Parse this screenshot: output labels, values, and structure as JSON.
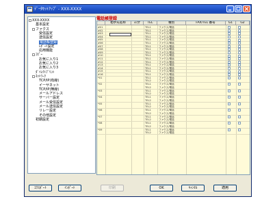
{
  "window": {
    "title": "ﾃﾞｰﾀｾｯﾄｱｯﾌﾟ - XXX-XXXX"
  },
  "tree": {
    "items": [
      {
        "label": "XXX-XXXX",
        "level": 0,
        "expander": true
      },
      {
        "label": "基本設定",
        "level": 1
      },
      {
        "label": "ファクス",
        "level": 1,
        "expander": true
      },
      {
        "label": "受信設定",
        "level": 2
      },
      {
        "label": "送信設定",
        "level": 2
      },
      {
        "label": "電話帳登録",
        "level": 2,
        "selected": true
      },
      {
        "label": "ﾚﾎﾟｰﾄ設定",
        "level": 2
      },
      {
        "label": "応用機能",
        "level": 2
      },
      {
        "label": "ｺﾋﾟｰ",
        "level": 1,
        "expander": true
      },
      {
        "label": "お気に入り1",
        "level": 2
      },
      {
        "label": "お気に入り2",
        "level": 2
      },
      {
        "label": "お気に入り3",
        "level": 2
      },
      {
        "label": "ﾀﾞｲﾚｸﾄﾌﾟﾘﾝﾄ",
        "level": 1
      },
      {
        "label": "ﾈｯﾄﾜｰｸ",
        "level": 1,
        "expander": true
      },
      {
        "label": "TCP/IP(有線)",
        "level": 2
      },
      {
        "label": "イーサネット",
        "level": 2
      },
      {
        "label": "TCP/IP(無線)",
        "level": 2
      },
      {
        "label": "メールアドレス",
        "level": 2
      },
      {
        "label": "サーバー設定",
        "level": 2
      },
      {
        "label": "メール受信設定",
        "level": 2
      },
      {
        "label": "メール送信設定",
        "level": 2
      },
      {
        "label": "リレー設定",
        "level": 2
      },
      {
        "label": "その他設定",
        "level": 2
      },
      {
        "label": "初期設定",
        "level": 1
      }
    ]
  },
  "phonebook": {
    "title": "電話帳登録",
    "headers": [
      "",
      "相手先名称",
      "ﾖﾐｶﾅ",
      "TEL",
      "種別",
      "FAX/TEL 番号",
      "G1",
      "G2"
    ],
    "rows": [
      {
        "no": "#01",
        "tel": "TEL1",
        "type": "ファクス/電話"
      },
      {
        "no": "#02",
        "tel": "TEL1",
        "type": "ファクス/電話"
      },
      {
        "no": "#03",
        "tel": "TEL1",
        "type": "ファクス/電話"
      },
      {
        "no": "#04",
        "tel": "TEL1",
        "type": "ファクス/電話"
      },
      {
        "no": "#05",
        "tel": "TEL1",
        "type": "ファクス/電話"
      },
      {
        "no": "#06",
        "tel": "TEL1",
        "type": "ファクス/電話"
      },
      {
        "no": "#07",
        "tel": "TEL1",
        "type": "ファクス/電話"
      },
      {
        "no": "#08",
        "tel": "TEL1",
        "type": "ファクス/電話"
      },
      {
        "no": "#09",
        "tel": "TEL1",
        "type": "ファクス/電話"
      },
      {
        "no": "#10",
        "tel": "TEL1",
        "type": "ファクス/電話"
      },
      {
        "no": "#11",
        "tel": "TEL1",
        "type": "ファクス/電話"
      },
      {
        "no": "#12",
        "tel": "TEL1",
        "type": "ファクス/電話"
      },
      {
        "no": "#13",
        "tel": "TEL1",
        "type": "ファクス/電話"
      },
      {
        "no": "#14",
        "tel": "TEL1",
        "type": "ファクス/電話"
      },
      {
        "no": "#15",
        "tel": "TEL1",
        "type": "ファクス/電話"
      },
      {
        "no": "#16",
        "tel": "TEL1",
        "type": "ファクス/電話"
      },
      {
        "no": "*01",
        "tel": "TEL1",
        "type": "ファクス/電話",
        "tel2": "TEL2",
        "type2": "ファクス/電話"
      },
      {
        "no": "*02",
        "tel": "TEL1",
        "type": "ファクス/電話",
        "tel2": "TEL2",
        "type2": "ファクス/電話"
      },
      {
        "no": "*03",
        "tel": "TEL1",
        "type": "ファクス/電話",
        "tel2": "TEL2",
        "type2": "ファクス/電話"
      },
      {
        "no": "*04",
        "tel": "TEL1",
        "type": "ファクス/電話",
        "tel2": "TEL2",
        "type2": "ファクス/電話"
      },
      {
        "no": "*05",
        "tel": "TEL1",
        "type": "ファクス/電話",
        "tel2": "TEL2",
        "type2": "ファクス/電話"
      },
      {
        "no": "*06",
        "tel": "TEL1",
        "type": "ファクス/電話",
        "tel2": "TEL2",
        "type2": "ファクス/電話"
      },
      {
        "no": "*07",
        "tel": "TEL1",
        "type": "ファクス/電話",
        "tel2": "TEL2",
        "type2": "ファクス/電話"
      },
      {
        "no": "*08",
        "tel": "TEL1",
        "type": "ファクス/電話",
        "tel2": "TEL2",
        "type2": "ファクス/電話"
      },
      {
        "no": "*09",
        "tel": "TEL1",
        "type": "ファクス/電話",
        "tel2": "TEL2",
        "type2": "ファクス/電話"
      }
    ]
  },
  "buttons": {
    "export": "ｴｸｽﾎﾟｰﾄ",
    "import": "ｲﾝﾎﾟｰﾄ",
    "print": "印刷",
    "ok": "OK",
    "cancel": "ｷｬﾝｾﾙ",
    "apply": "適用"
  },
  "colors": {
    "accent": "#316ac5",
    "grid_bg": "#fffbd8",
    "title_red": "#cc0000"
  }
}
